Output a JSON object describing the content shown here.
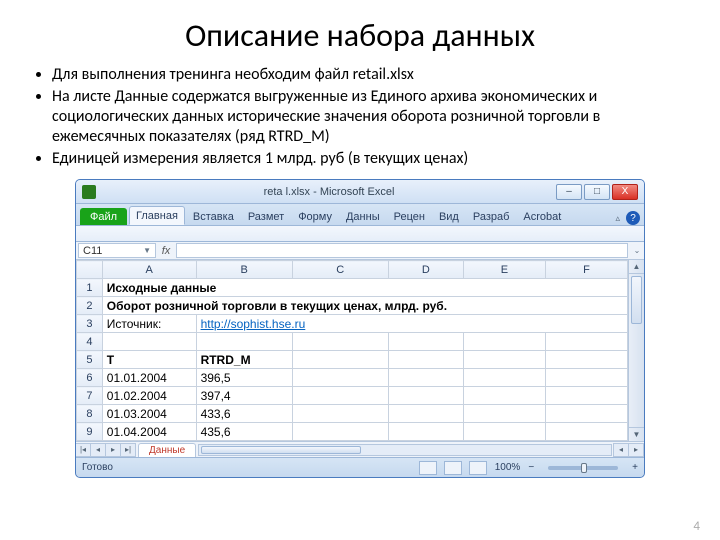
{
  "slide": {
    "title": "Описание набора данных",
    "bullets": [
      "Для выполнения тренинга необходим файл retail.xlsx",
      "На листе Данные содержатся выгруженные из Единого архива экономических и социологических данных исторические значения оборота розничной торговли в ежемесячных показателях (ряд RTRD_M)",
      "Единицей измерения является 1 млрд. руб (в текущих ценах)"
    ],
    "page_number": "4"
  },
  "excel": {
    "title": "reta l.xlsx - Microsoft Excel",
    "window_buttons": {
      "min": "–",
      "max": "□",
      "close": "X"
    },
    "ribbon": {
      "file": "Файл",
      "tabs": [
        "Главная",
        "Вставка",
        "Размет",
        "Форму",
        "Данны",
        "Рецен",
        "Вид",
        "Разраб",
        "Acrobat"
      ],
      "active_index": 0
    },
    "namebox": "C11",
    "fx_label": "fx",
    "columns": [
      "A",
      "B",
      "C",
      "D",
      "E",
      "F"
    ],
    "rows": [
      {
        "n": "1",
        "A": "Исходные данные",
        "A_bold": true
      },
      {
        "n": "2",
        "A": "Оборот розничной торговли в текущих ценах, млрд. руб.",
        "A_bold": true
      },
      {
        "n": "3",
        "A": "Источник:",
        "B": "http://sophist.hse.ru",
        "B_link": true
      },
      {
        "n": "4"
      },
      {
        "n": "5",
        "A": "T",
        "B": "RTRD_M",
        "header": true
      },
      {
        "n": "6",
        "A": "01.01.2004",
        "B": "396,5"
      },
      {
        "n": "7",
        "A": "01.02.2004",
        "B": "397,4"
      },
      {
        "n": "8",
        "A": "01.03.2004",
        "B": "433,6"
      },
      {
        "n": "9",
        "A": "01.04.2004",
        "B": "435,6"
      }
    ],
    "sheet_tab": "Данные",
    "status_left": "Готово",
    "zoom": "100%"
  }
}
